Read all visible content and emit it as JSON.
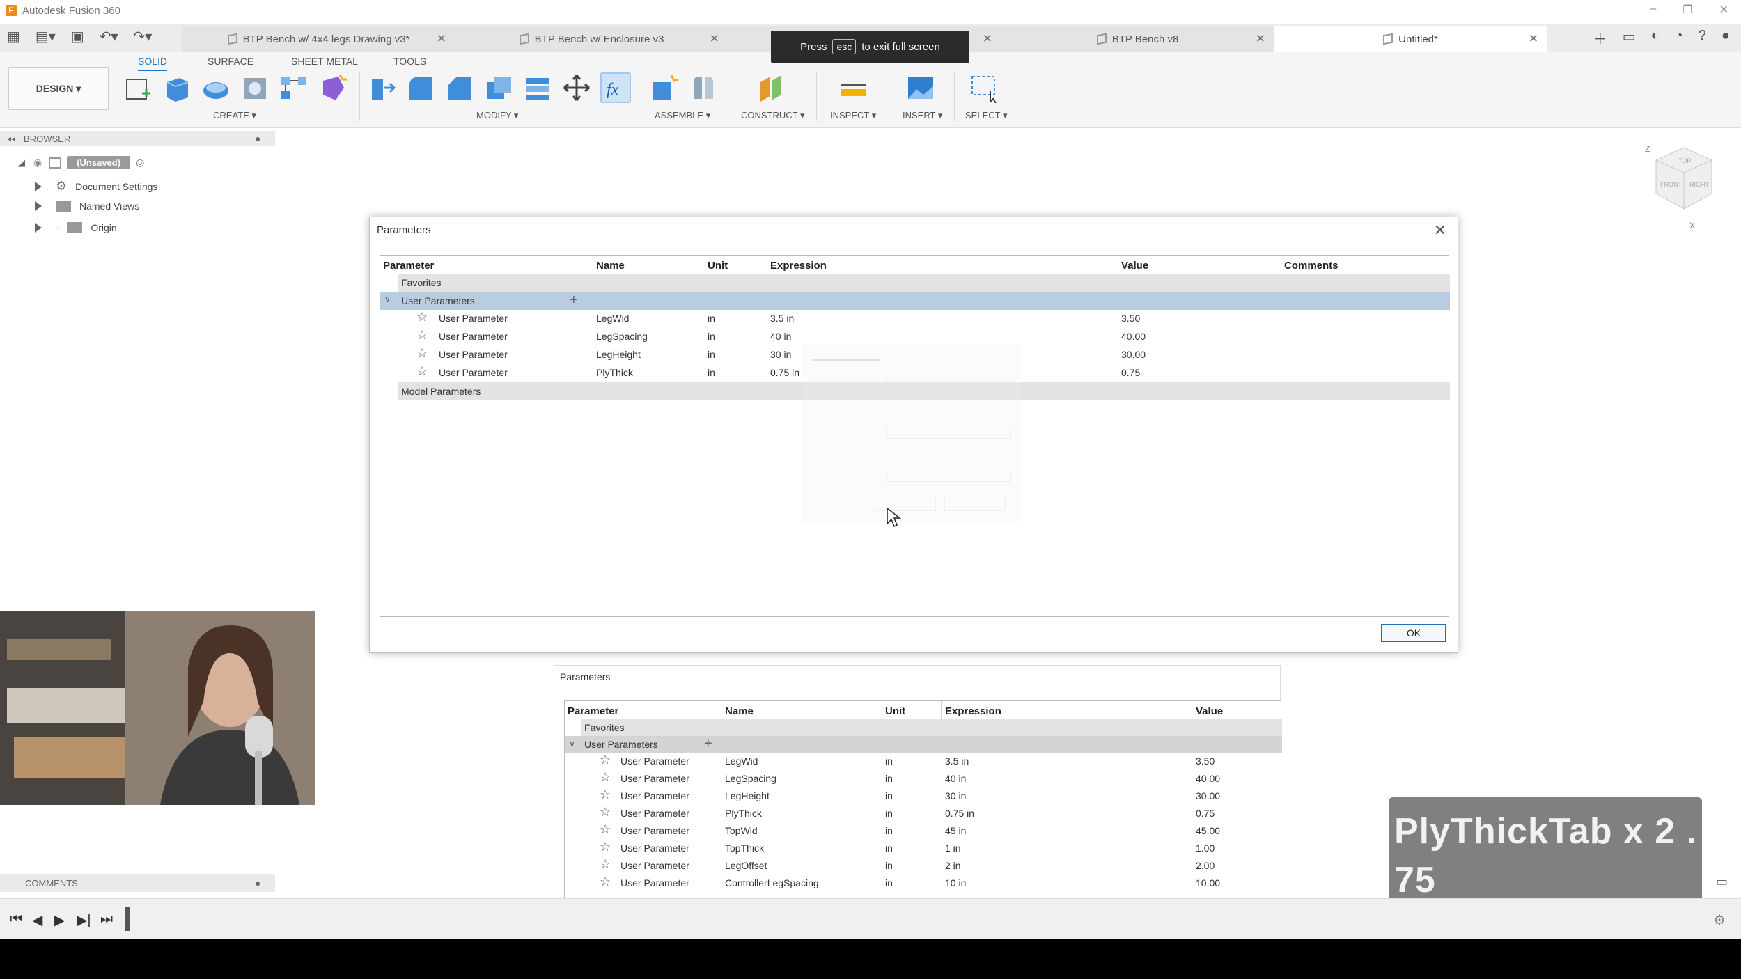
{
  "app": {
    "title": "Autodesk Fusion 360"
  },
  "tabs": [
    {
      "label": "BTP Bench w/ 4x4 legs Drawing v3*"
    },
    {
      "label": "BTP Bench w/ Enclosure v3"
    },
    {
      "label": ""
    },
    {
      "label": "BTP Bench v8"
    },
    {
      "label": "Untitled*"
    }
  ],
  "fullscreen_toast": {
    "press": "Press",
    "key": "esc",
    "message": "to exit full screen"
  },
  "toolbar": {
    "design_label": "DESIGN ▾",
    "workspace_tabs": [
      "SOLID",
      "SURFACE",
      "SHEET METAL",
      "TOOLS"
    ],
    "groups": [
      "CREATE ▾",
      "MODIFY ▾",
      "ASSEMBLE ▾",
      "CONSTRUCT ▾",
      "INSPECT ▾",
      "INSERT ▾",
      "SELECT ▾"
    ],
    "accent": "#1a73c8"
  },
  "browser": {
    "header": "BROWSER",
    "root_label": "(Unsaved)",
    "items": [
      "Document Settings",
      "Named Views",
      "Origin"
    ]
  },
  "dialog_main": {
    "title": "Parameters",
    "columns": [
      "Parameter",
      "Name",
      "Unit",
      "Expression",
      "Value",
      "Comments"
    ],
    "favorites_label": "Favorites",
    "user_params_label": "User Parameters",
    "model_params_label": "Model Parameters",
    "rows": [
      {
        "param": "User Parameter",
        "name": "LegWid",
        "unit": "in",
        "expr": "3.5 in",
        "value": "3.50"
      },
      {
        "param": "User Parameter",
        "name": "LegSpacing",
        "unit": "in",
        "expr": "40 in",
        "value": "40.00"
      },
      {
        "param": "User Parameter",
        "name": "LegHeight",
        "unit": "in",
        "expr": "30 in",
        "value": "30.00"
      },
      {
        "param": "User Parameter",
        "name": "PlyThick",
        "unit": "in",
        "expr": "0.75 in",
        "value": "0.75"
      }
    ],
    "ok_label": "OK"
  },
  "dialog_second": {
    "title": "Parameters",
    "columns": [
      "Parameter",
      "Name",
      "Unit",
      "Expression",
      "Value"
    ],
    "favorites_label": "Favorites",
    "user_params_label": "User Parameters",
    "rows": [
      {
        "param": "User Parameter",
        "name": "LegWid",
        "unit": "in",
        "expr": "3.5 in",
        "value": "3.50"
      },
      {
        "param": "User Parameter",
        "name": "LegSpacing",
        "unit": "in",
        "expr": "40 in",
        "value": "40.00"
      },
      {
        "param": "User Parameter",
        "name": "LegHeight",
        "unit": "in",
        "expr": "30 in",
        "value": "30.00"
      },
      {
        "param": "User Parameter",
        "name": "PlyThick",
        "unit": "in",
        "expr": "0.75 in",
        "value": "0.75"
      },
      {
        "param": "User Parameter",
        "name": "TopWid",
        "unit": "in",
        "expr": "45 in",
        "value": "45.00"
      },
      {
        "param": "User Parameter",
        "name": "TopThick",
        "unit": "in",
        "expr": "1 in",
        "value": "1.00"
      },
      {
        "param": "User Parameter",
        "name": "LegOffset",
        "unit": "in",
        "expr": "2 in",
        "value": "2.00"
      },
      {
        "param": "User Parameter",
        "name": "ControllerLegSpacing",
        "unit": "in",
        "expr": "10 in",
        "value": "10.00"
      }
    ]
  },
  "overlay": {
    "line1": "PlyThickTab x 2 .",
    "line2": "75"
  },
  "comments": {
    "label": "COMMENTS"
  },
  "viewcube": {
    "top": "TOP",
    "front": "FRONT",
    "right": "RIGHT",
    "z": "Z",
    "x": "X"
  }
}
